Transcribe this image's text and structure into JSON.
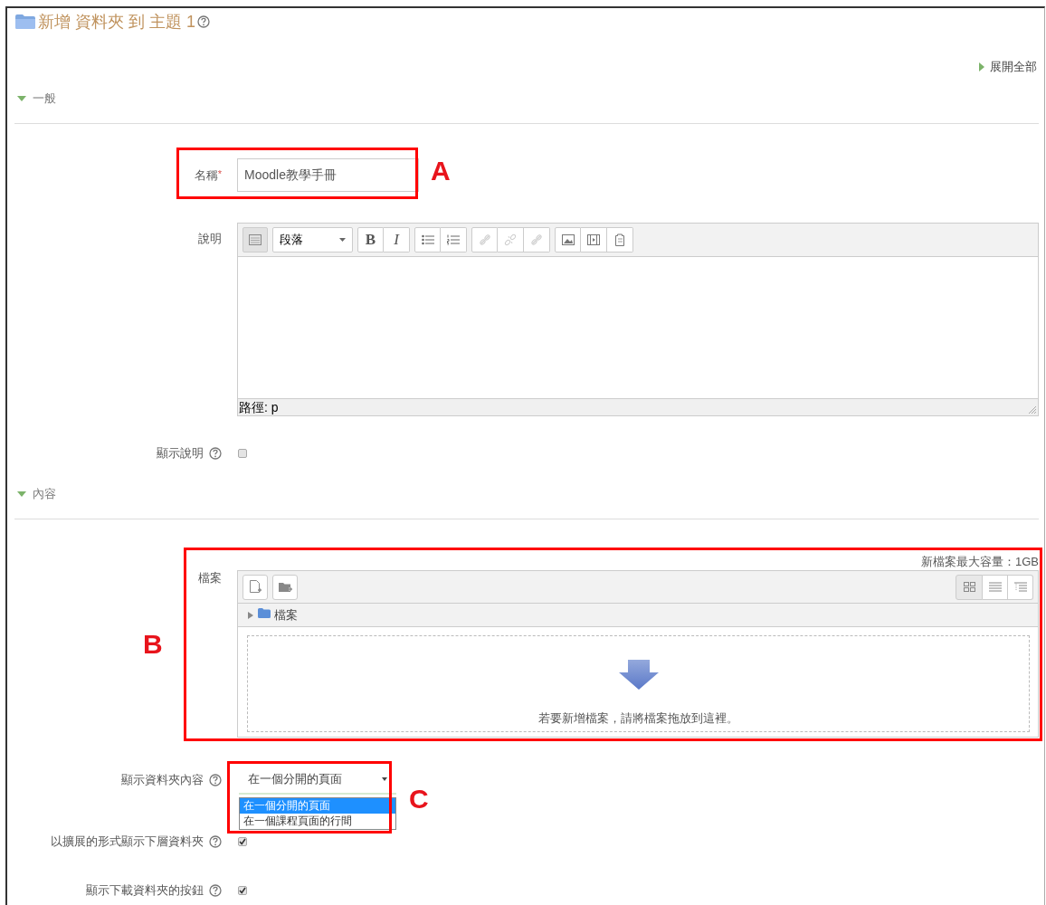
{
  "header": {
    "title": "新增 資料夾 到 主題 1",
    "help": true
  },
  "expand_all": "展開全部",
  "sections": [
    {
      "title": "一般",
      "expanded": true,
      "fields": [
        {
          "kind": "text",
          "label": "名稱",
          "required_mark": "*",
          "value": "Moodle教學手冊"
        },
        {
          "kind": "editor",
          "label": "說明",
          "format": "段落",
          "bold": "B",
          "italic": "I",
          "path": "路徑: p"
        },
        {
          "kind": "checkbox",
          "label": "顯示說明",
          "help": true,
          "checked": false
        }
      ]
    },
    {
      "title": "內容",
      "expanded": true,
      "fields": [
        {
          "kind": "filemanager",
          "label": "檔案",
          "max_size": "新檔案最大容量：1GB",
          "folder": "檔案",
          "drop_hint": "若要新增檔案，請將檔案拖放到這裡。"
        },
        {
          "kind": "select",
          "label": "顯示資料夾內容",
          "help": true,
          "value": "在一個分開的頁面",
          "expanded": true,
          "options": [
            {
              "label": "在一個分開的頁面",
              "selected": true
            },
            {
              "label": "在一個課程頁面的行間",
              "selected": false
            }
          ]
        },
        {
          "kind": "checkbox",
          "label": "以擴展的形式顯示下層資料夾",
          "help": true,
          "checked": true
        },
        {
          "kind": "checkbox",
          "label": "顯示下載資料夾的按鈕",
          "help": true,
          "checked": true
        }
      ]
    }
  ],
  "annotations": [
    {
      "label": "A"
    },
    {
      "label": "B"
    },
    {
      "label": "C"
    }
  ]
}
